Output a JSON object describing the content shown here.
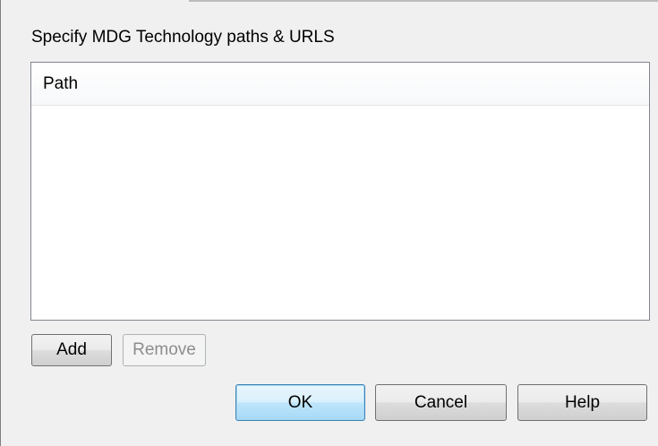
{
  "group": {
    "label": "Specify MDG Technology paths & URLS"
  },
  "list": {
    "columns": [
      "Path"
    ],
    "rows": []
  },
  "buttons": {
    "add": "Add",
    "remove": "Remove",
    "ok": "OK",
    "cancel": "Cancel",
    "help": "Help"
  },
  "state": {
    "remove_enabled": false,
    "default_button": "OK"
  }
}
